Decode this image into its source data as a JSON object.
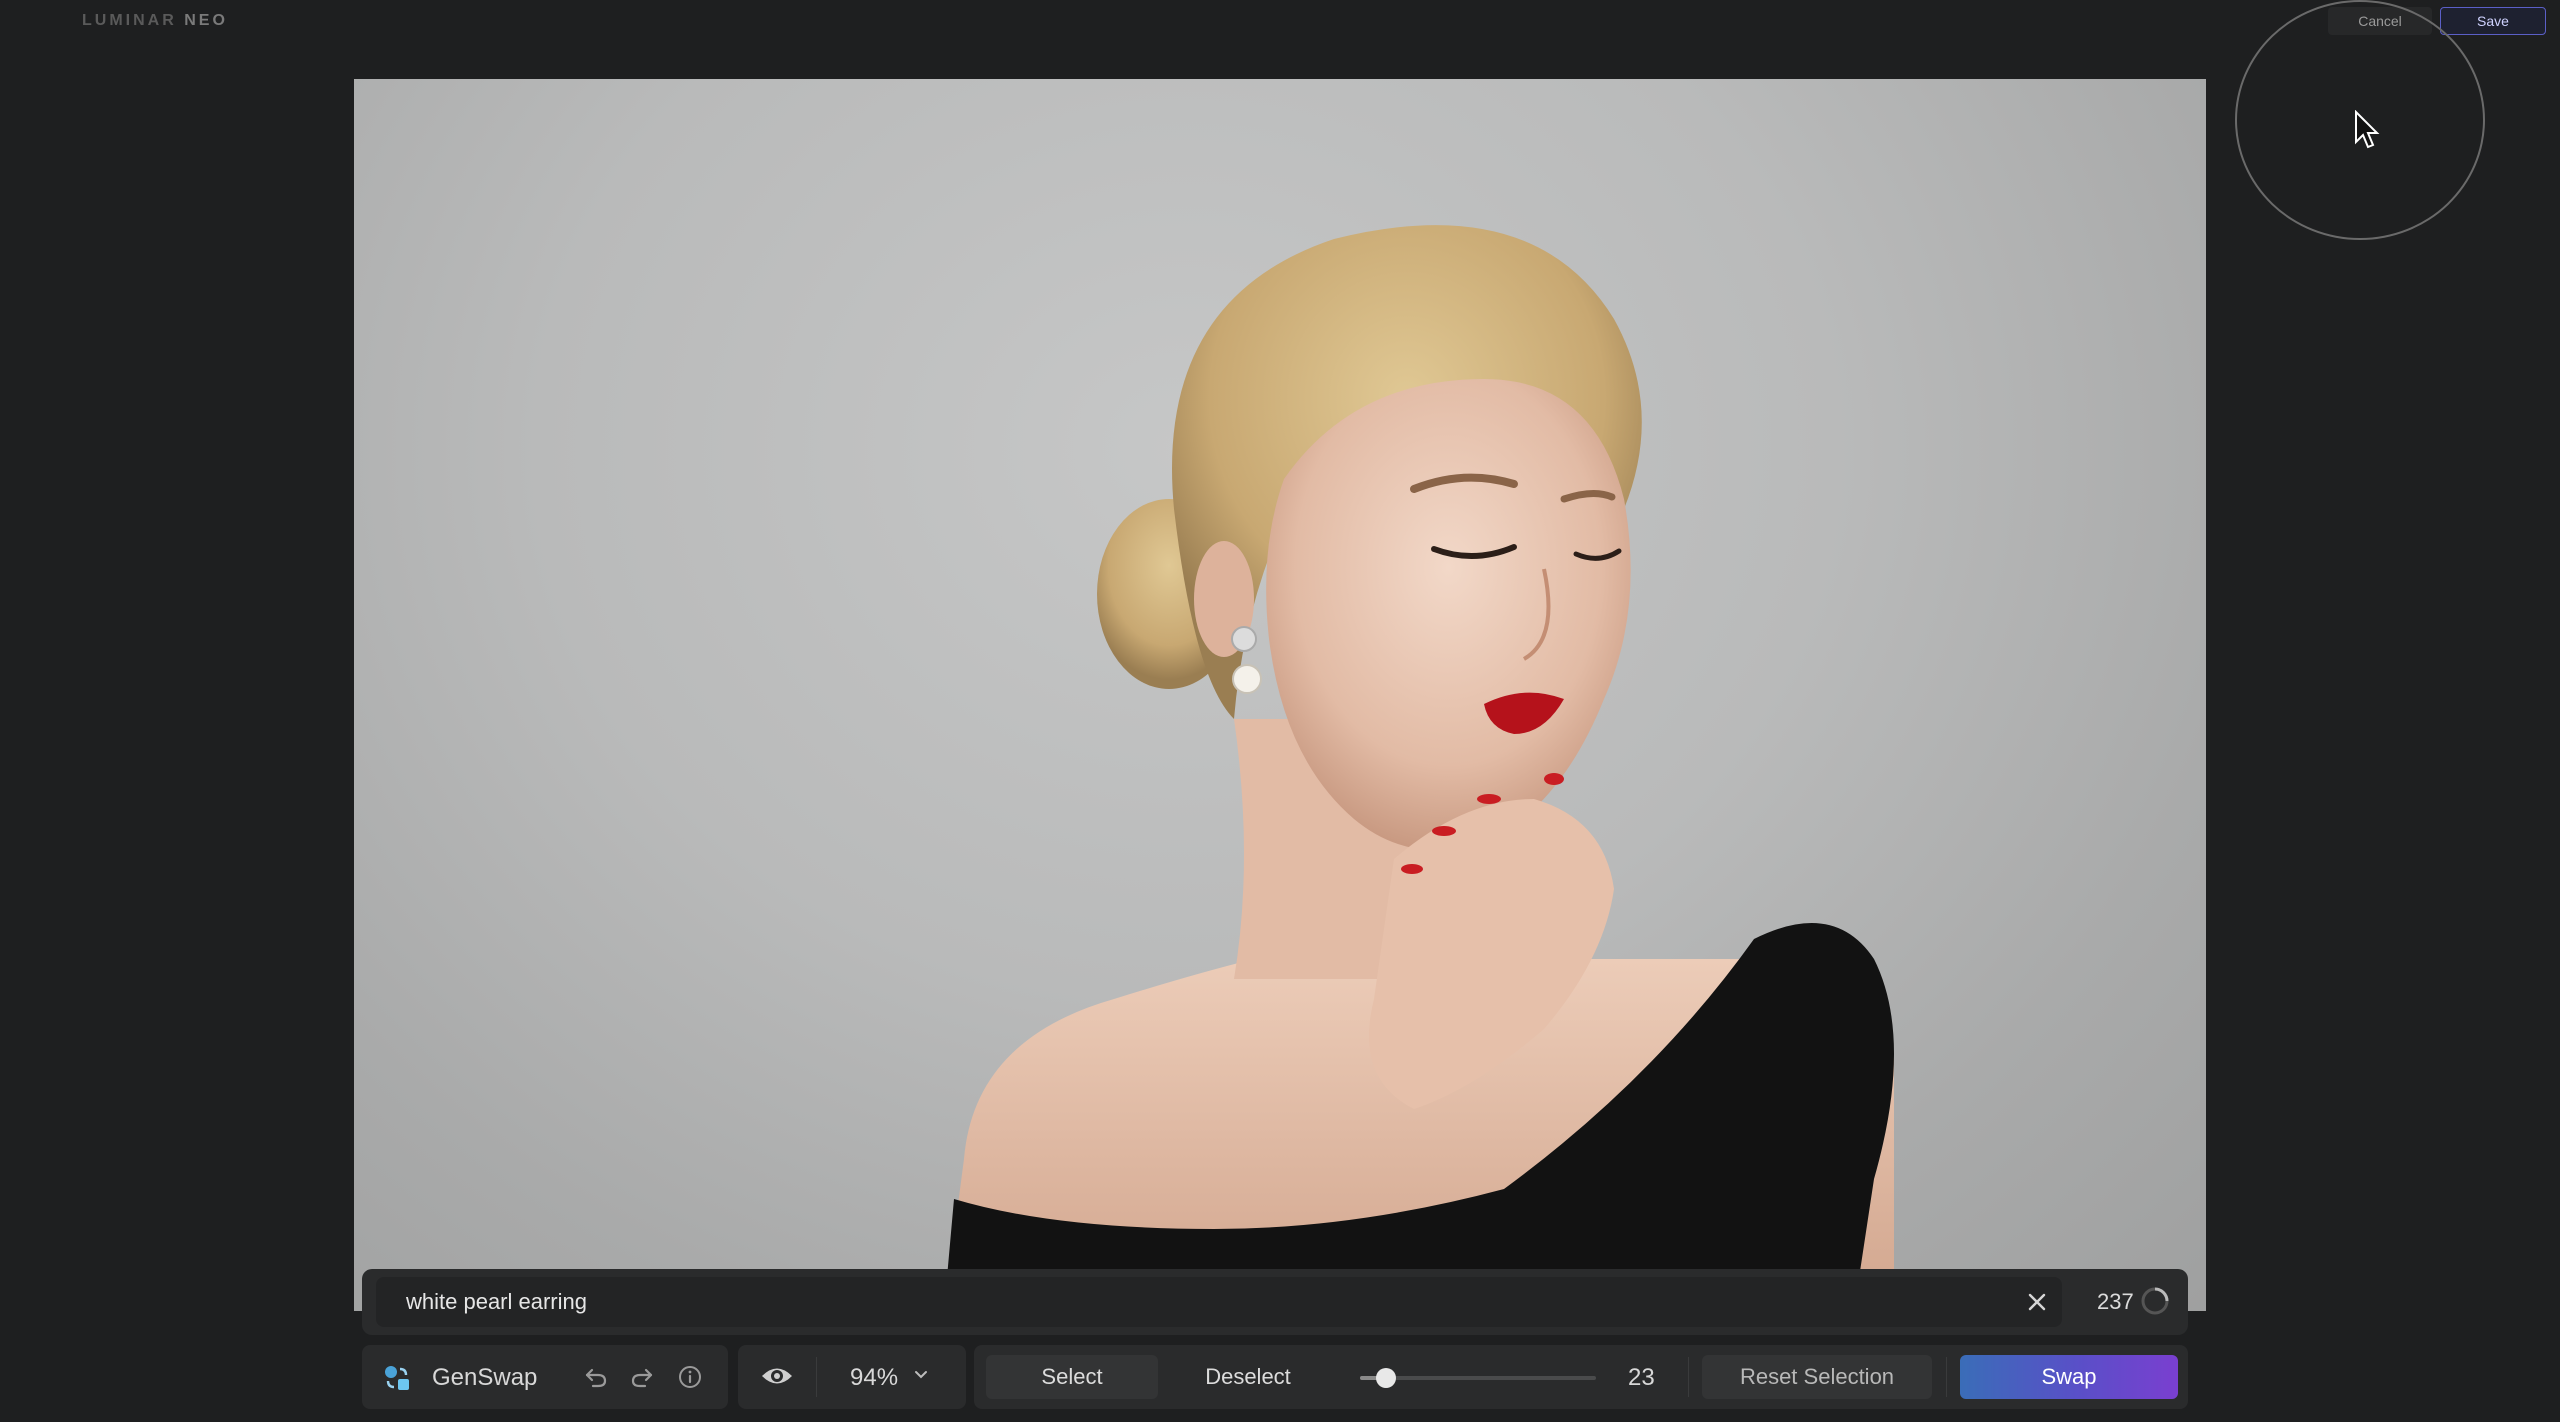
{
  "app": {
    "logo_main": "LUMINAR",
    "logo_accent": "NEO",
    "cancel_label": "Cancel",
    "save_label": "Save"
  },
  "prompt": {
    "value": "white pearl earring",
    "remaining_chars": "237"
  },
  "toolbar": {
    "tool_name": "GenSwap",
    "zoom": "94%",
    "select_label": "Select",
    "deselect_label": "Deselect",
    "brush_size": "23",
    "brush_size_fraction": 0.11,
    "reset_label": "Reset Selection",
    "swap_label": "Swap"
  },
  "icons": [
    "genswap-icon",
    "undo-icon",
    "redo-icon",
    "info-icon",
    "eye-icon",
    "chevron-down-icon",
    "close-icon",
    "cursor-icon"
  ],
  "colors": {
    "background": "#1e1f20",
    "panel": "#2a2b2c",
    "accent_start": "#3a6db8",
    "accent_end": "#7a3fd0"
  }
}
